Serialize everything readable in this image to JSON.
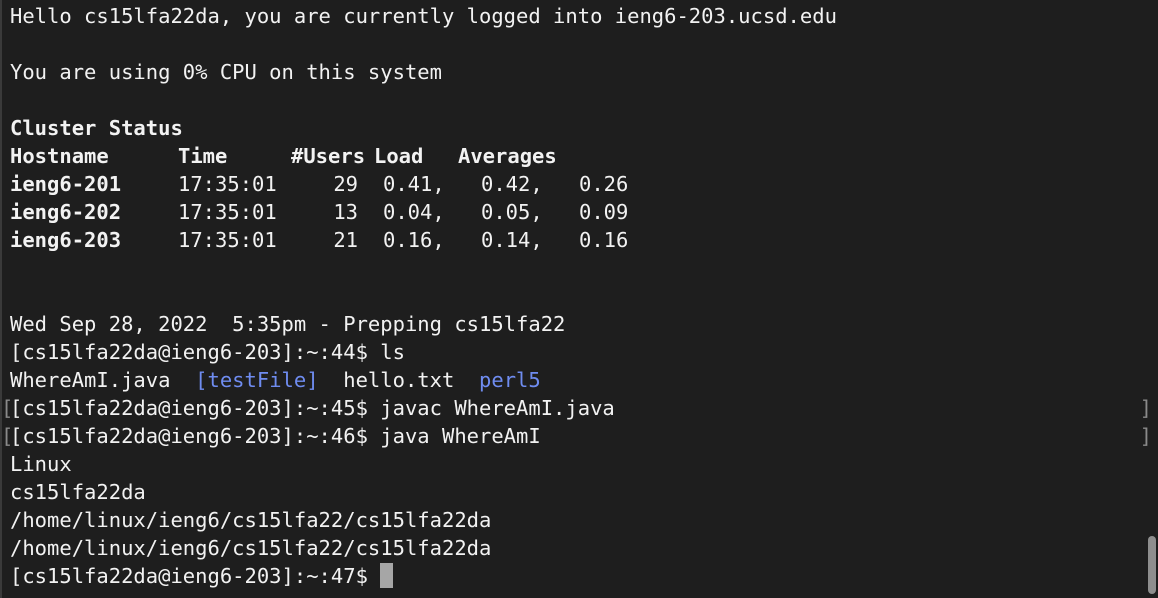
{
  "motd": {
    "greeting": "Hello cs15lfa22da, you are currently logged into ieng6-203.ucsd.edu",
    "cpu": "You are using 0% CPU on this system"
  },
  "cluster": {
    "title": "Cluster Status",
    "headers": {
      "hostname": "Hostname",
      "time": "Time",
      "users": "#Users",
      "load": "Load",
      "averages": "Averages"
    },
    "rows": [
      {
        "host": "ieng6-201",
        "time": "17:35:01",
        "users": "29",
        "l1": "0.41,",
        "l2": "0.42,",
        "l3": "0.26"
      },
      {
        "host": "ieng6-202",
        "time": "17:35:01",
        "users": "13",
        "l1": "0.04,",
        "l2": "0.05,",
        "l3": "0.09"
      },
      {
        "host": "ieng6-203",
        "time": "17:35:01",
        "users": "21",
        "l1": "0.16,",
        "l2": "0.14,",
        "l3": "0.16"
      }
    ]
  },
  "session": {
    "date_line": "Wed Sep 28, 2022  5:35pm - Prepping cs15lfa22",
    "prompt44": "[cs15lfa22da@ieng6-203]:~:44$ ",
    "cmd44": "ls",
    "ls_output": {
      "file1": "WhereAmI.java",
      "dir1": "[testFile]",
      "file2": "hello.txt",
      "dir2": "perl5"
    },
    "prompt45": "[cs15lfa22da@ieng6-203]:~:45$ ",
    "cmd45": "javac WhereAmI.java",
    "prompt46": "[cs15lfa22da@ieng6-203]:~:46$ ",
    "cmd46": "java WhereAmI",
    "output": [
      "Linux",
      "cs15lfa22da",
      "/home/linux/ieng6/cs15lfa22/cs15lfa22da",
      "/home/linux/ieng6/cs15lfa22/cs15lfa22da"
    ],
    "prompt47": "[cs15lfa22da@ieng6-203]:~:47$ ",
    "mark_left": "[",
    "mark_right": "]"
  },
  "colors": {
    "background": "#1e1e1e",
    "foreground": "#f2f2f2",
    "directory": "#6f8cf0",
    "cursor": "#a6a6a6"
  }
}
